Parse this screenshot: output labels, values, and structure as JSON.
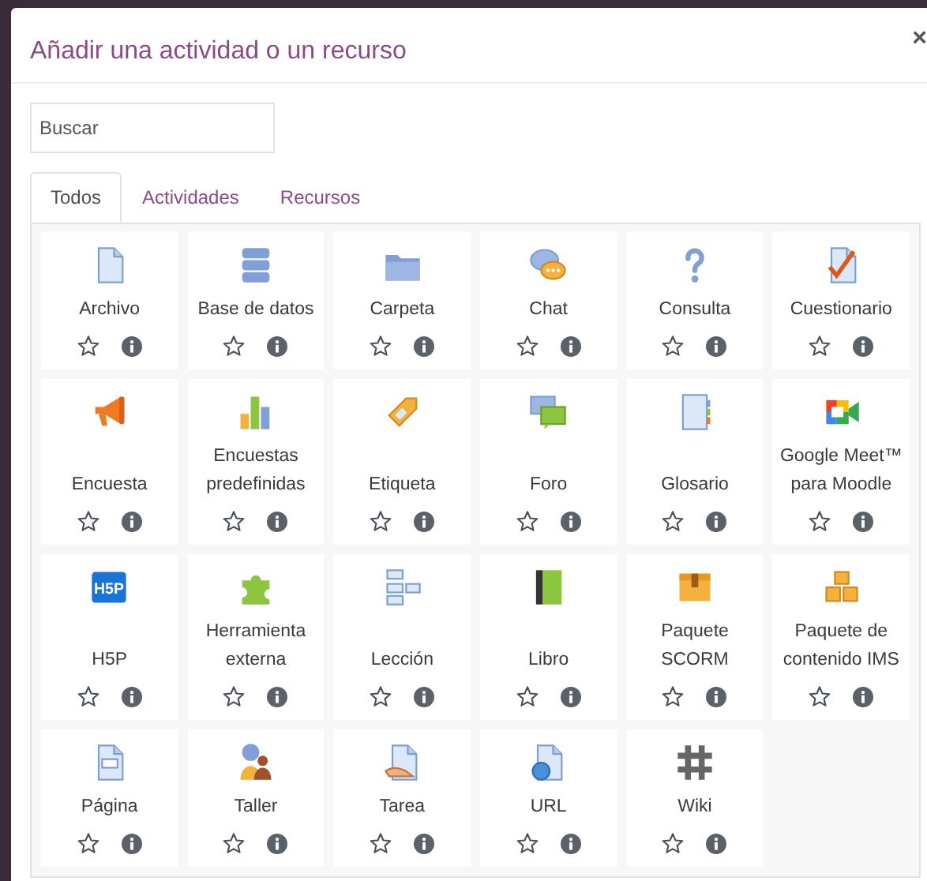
{
  "dialog": {
    "title": "Añadir una actividad o un recurso",
    "close": "×"
  },
  "search": {
    "placeholder": "Buscar"
  },
  "tabs": [
    {
      "label": "Todos",
      "selected": true
    },
    {
      "label": "Actividades",
      "selected": false
    },
    {
      "label": "Recursos",
      "selected": false
    }
  ],
  "modules": [
    {
      "label": "Archivo",
      "kind": "file",
      "favourite": false
    },
    {
      "label": "Base de datos",
      "kind": "database",
      "favourite": false
    },
    {
      "label": "Carpeta",
      "kind": "folder",
      "favourite": false
    },
    {
      "label": "Chat",
      "kind": "chat",
      "favourite": false
    },
    {
      "label": "Consulta",
      "kind": "question",
      "favourite": false
    },
    {
      "label": "Cuestionario",
      "kind": "quiz",
      "favourite": false
    },
    {
      "label": "Encuesta",
      "kind": "megaphone",
      "favourite": false
    },
    {
      "label": "Encuestas predefinidas",
      "kind": "barchart",
      "favourite": false
    },
    {
      "label": "Etiqueta",
      "kind": "tag",
      "favourite": false
    },
    {
      "label": "Foro",
      "kind": "forum",
      "favourite": false
    },
    {
      "label": "Glosario",
      "kind": "glossary",
      "favourite": false
    },
    {
      "label": "Google Meet™ para Moodle",
      "kind": "video",
      "favourite": false
    },
    {
      "label": "H5P",
      "kind": "h5p",
      "logo": "H5P",
      "favourite": false
    },
    {
      "label": "Herramienta externa",
      "kind": "puzzle",
      "favourite": false
    },
    {
      "label": "Lección",
      "kind": "flow",
      "favourite": false
    },
    {
      "label": "Libro",
      "kind": "book",
      "favourite": false
    },
    {
      "label": "Paquete SCORM",
      "kind": "box",
      "favourite": false
    },
    {
      "label": "Paquete de contenido IMS",
      "kind": "boxes",
      "favourite": false
    },
    {
      "label": "Página",
      "kind": "page",
      "favourite": false
    },
    {
      "label": "Taller",
      "kind": "people",
      "favourite": false
    },
    {
      "label": "Tarea",
      "kind": "hand",
      "favourite": false
    },
    {
      "label": "URL",
      "kind": "globe",
      "favourite": false
    },
    {
      "label": "Wiki",
      "kind": "hash",
      "favourite": false
    }
  ]
}
